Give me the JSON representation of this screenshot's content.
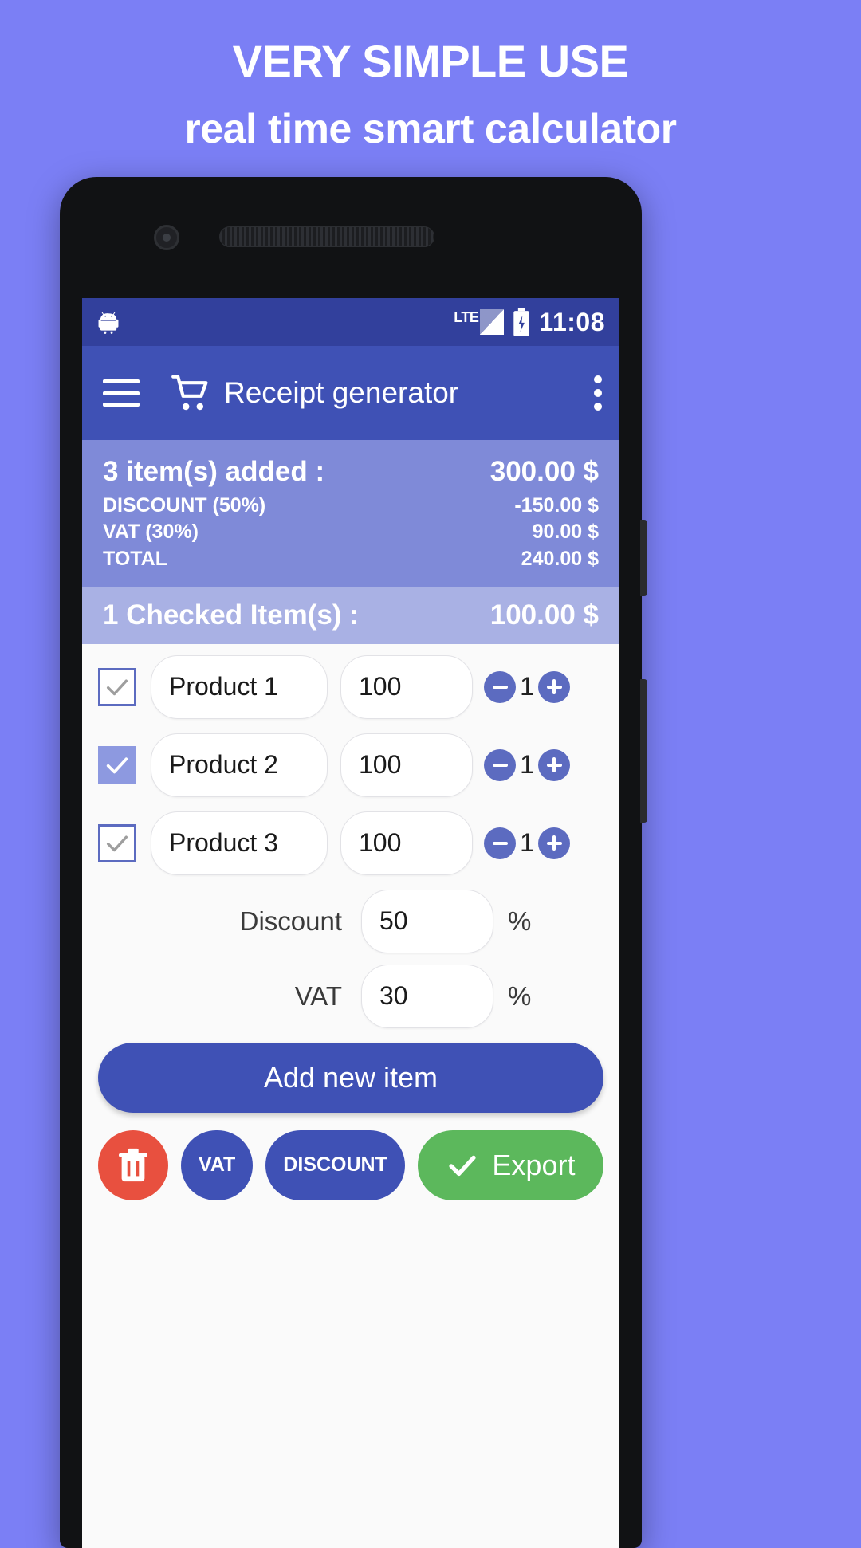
{
  "promo": {
    "headline": "VERY SIMPLE USE",
    "subheadline": "real time smart calculator"
  },
  "statusbar": {
    "network_label": "LTE",
    "time": "11:08",
    "android_icon": "android-robot-icon",
    "battery_icon": "battery-charging-icon"
  },
  "appbar": {
    "title": "Receipt generator",
    "menu_icon": "hamburger-menu-icon",
    "app_icon": "shopping-cart-icon",
    "overflow_icon": "kebab-menu-icon"
  },
  "summary": {
    "items_added_label": "3 item(s) added :",
    "items_added_value": "300.00 $",
    "rows": [
      {
        "label": "DISCOUNT (50%)",
        "value": "-150.00 $"
      },
      {
        "label": "VAT (30%)",
        "value": "90.00 $"
      },
      {
        "label": "TOTAL",
        "value": "240.00 $"
      }
    ]
  },
  "checked": {
    "label": "1 Checked Item(s) :",
    "value": "100.00 $"
  },
  "items": [
    {
      "name": "Product 1",
      "price": "100",
      "qty": "1",
      "checked": false
    },
    {
      "name": "Product 2",
      "price": "100",
      "qty": "1",
      "checked": true
    },
    {
      "name": "Product 3",
      "price": "100",
      "qty": "1",
      "checked": false
    }
  ],
  "rates": [
    {
      "label": "Discount",
      "value": "50",
      "unit": "%"
    },
    {
      "label": "VAT",
      "value": "30",
      "unit": "%"
    }
  ],
  "add_button": {
    "label": "Add new item"
  },
  "actions": {
    "delete_icon": "trash-icon",
    "vat_label": "VAT",
    "discount_label": "DISCOUNT",
    "export_label": "Export",
    "export_icon": "check-icon"
  },
  "colors": {
    "background": "#7b7ff5",
    "statusbar": "#32409c",
    "appbar": "#3f51b5",
    "summary_panel": "#7f8ad8",
    "checked_bar": "#a9b1e4",
    "accent": "#5c6bc0",
    "danger": "#e8503f",
    "success": "#5cb85c"
  }
}
